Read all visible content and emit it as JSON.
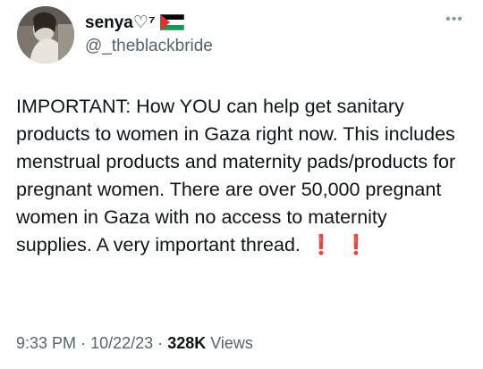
{
  "author": {
    "display_name": "senya♡⁷",
    "flag_icon": "palestine-flag-icon",
    "handle": "@_theblackbride"
  },
  "more_icon": "more-dots-icon",
  "tweet": {
    "text": "IMPORTANT: How YOU can help get sanitary products to women in Gaza right now. This includes menstrual products and maternity pads/products for pregnant women. There are over 50,000 pregnant women in Gaza with no access to maternity supplies. A very important thread.",
    "emphasis_1": "❗",
    "emphasis_2": "❗",
    "time": "9:33 PM",
    "date": "10/22/23",
    "separator": "·",
    "views_count": "328K",
    "views_label": "Views"
  },
  "colors": {
    "text_primary": "#0f1419",
    "text_secondary": "#536471",
    "emphasis": "#e0141e"
  }
}
